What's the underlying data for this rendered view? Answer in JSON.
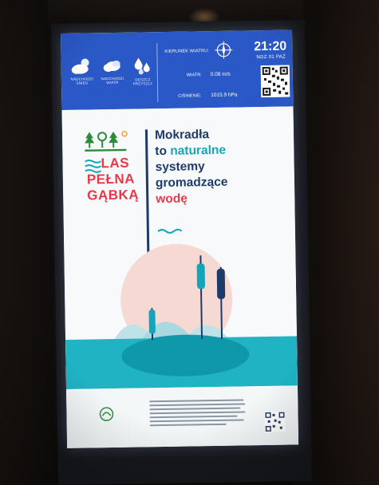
{
  "weather_bar": {
    "conditions": [
      {
        "label": "NADCHODZI SNIEG",
        "icon": "partly-cloudy-icon"
      },
      {
        "label": "NADCHODZI WIATR",
        "icon": "cloudy-icon"
      },
      {
        "label": "DESZCZ PRZYSZLY",
        "icon": "raindrops-icon"
      }
    ],
    "wind_label": "KIERUNEK WIATRU:",
    "humidity_label": "WIATR:",
    "humidity_value": "0.08 m/s",
    "pressure_label": "CIŚNIENIE:",
    "pressure_value": "1015.9 hPa",
    "time": "21:20",
    "date": "NDZ 01 PAŹ"
  },
  "poster": {
    "logo": {
      "line1": "LAS",
      "line2": "PEŁNA",
      "line3": "GĄBKĄ"
    },
    "headline": {
      "line1": "Mokradła",
      "line2_a": "to ",
      "line2_b": "naturalne",
      "line3": "systemy",
      "line4": "gromadzące",
      "line5": "wodę"
    },
    "colors": {
      "navy": "#1d3b6a",
      "teal": "#14a6b8",
      "red": "#e63a4a",
      "green": "#2e8b3a"
    }
  }
}
